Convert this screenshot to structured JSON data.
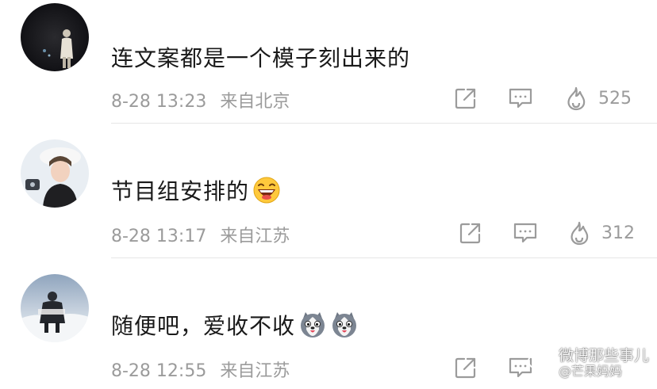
{
  "comments": [
    {
      "text": "连文案都是一个模子刻出来的",
      "time": "8-28 13:23",
      "location": "来自北京",
      "likes": "525",
      "emojis": []
    },
    {
      "text": "节目组安排的",
      "time": "8-28 13:17",
      "location": "来自江苏",
      "likes": "312",
      "emojis": [
        "laughing-emoji"
      ]
    },
    {
      "text": "随便吧，爱收不收",
      "time": "8-28 12:55",
      "location": "来自江苏",
      "likes": "",
      "emojis": [
        "husky-emoji",
        "husky-emoji"
      ]
    }
  ],
  "icons": {
    "share": "share-icon",
    "comment": "comment-icon",
    "like": "flame-icon"
  },
  "watermark": {
    "line1": "微博那些事儿",
    "line2": "@芒果妈妈"
  },
  "colors": {
    "meta_gray": "#9b9b9b",
    "text": "#1a1a1a",
    "divider": "#e6e6e6"
  }
}
